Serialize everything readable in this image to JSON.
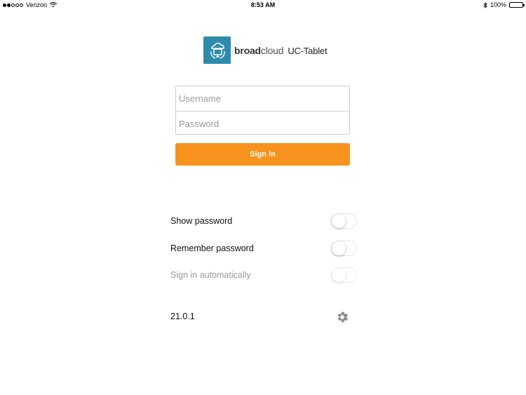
{
  "status_bar": {
    "carrier": "Verizon",
    "time": "8:53 AM",
    "battery": "100%",
    "icons": [
      "signal-dots-icon",
      "wifi-icon",
      "bluetooth-icon",
      "battery-icon"
    ]
  },
  "logo": {
    "brand_bold": "broad",
    "brand_thin": "cloud",
    "product": "UC-Tablet",
    "badge_color": "#2f8bad"
  },
  "login": {
    "username_placeholder": "Username",
    "password_placeholder": "Password",
    "signin_label": "Sign in",
    "signin_color": "#f7921e"
  },
  "options": [
    {
      "label": "Show password",
      "enabled": true,
      "on": false
    },
    {
      "label": "Remember password",
      "enabled": true,
      "on": false
    },
    {
      "label": "Sign in automatically",
      "enabled": false,
      "on": false
    }
  ],
  "footer": {
    "version": "21.0.1",
    "settings_icon": "gear-icon"
  }
}
